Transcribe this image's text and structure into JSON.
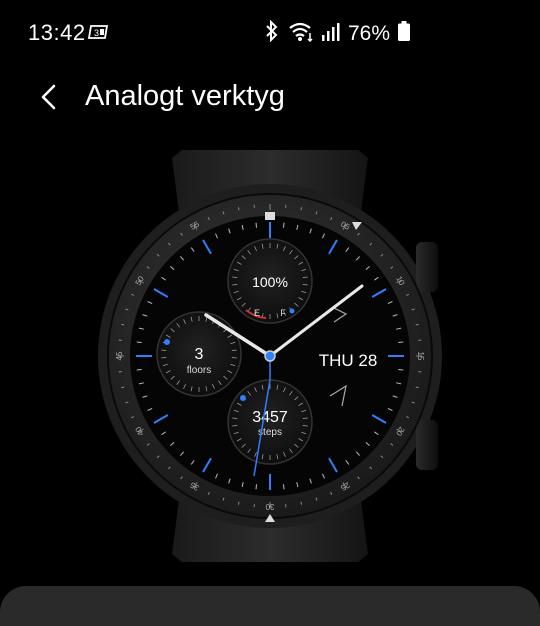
{
  "status_bar": {
    "time": "13:42",
    "notification_icon": "notification-badge-icon",
    "bluetooth_icon": "bluetooth-icon",
    "wifi_icon": "wifi-icon",
    "signal_icon": "signal-icon",
    "battery_text": "76%",
    "battery_icon": "battery-icon"
  },
  "app_bar": {
    "back_icon": "back-chevron-icon",
    "title": "Analogt verktyg"
  },
  "watch_face": {
    "bezel_labels": [
      "55",
      "05",
      "10",
      "15",
      "20",
      "25",
      "30",
      "35",
      "40",
      "45",
      "50"
    ],
    "battery_percent": "100%",
    "battery_empty_label": "E",
    "battery_full_label": "F",
    "floors_value": "3",
    "floors_label": "floors",
    "steps_value": "3457",
    "steps_label": "steps",
    "date_text": "THU 28",
    "accent_color": "#2f7fff"
  },
  "colors": {
    "background": "#000000",
    "bottom_panel": "#2a2a2a"
  }
}
